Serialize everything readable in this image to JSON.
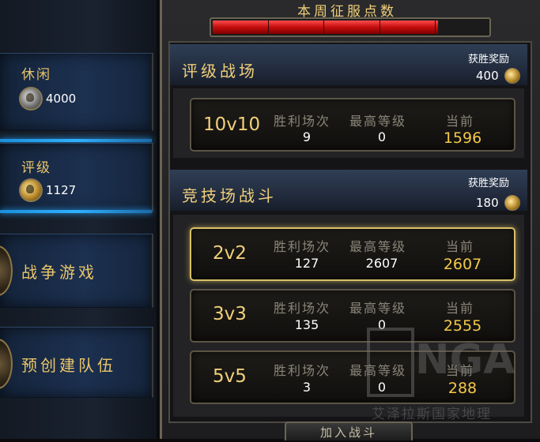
{
  "weekly_conquest": {
    "title": "本周征服点数",
    "progress": 0.82
  },
  "sidebar": {
    "items": [
      {
        "label": "休闲",
        "value": "4000",
        "icon": "silver-conquest-icon"
      },
      {
        "label": "评级",
        "value": "1127",
        "icon": "gold-conquest-icon"
      },
      {
        "label": "战争游戏"
      },
      {
        "label": "预创建队伍"
      }
    ]
  },
  "rated_battleground": {
    "title": "评级战场",
    "reward_label": "获胜奖励",
    "reward_value": "400",
    "rows": [
      {
        "bracket": "10v10",
        "wins_label": "胜利场次",
        "wins": "9",
        "best_label": "最高等级",
        "best": "0",
        "current_label": "当前",
        "current": "1596"
      }
    ]
  },
  "arena": {
    "title": "竞技场战斗",
    "reward_label": "获胜奖励",
    "reward_value": "180",
    "rows": [
      {
        "bracket": "2v2",
        "wins_label": "胜利场次",
        "wins": "127",
        "best_label": "最高等级",
        "best": "2607",
        "current_label": "当前",
        "current": "2607"
      },
      {
        "bracket": "3v3",
        "wins_label": "胜利场次",
        "wins": "135",
        "best_label": "最高等级",
        "best": "0",
        "current_label": "当前",
        "current": "2555"
      },
      {
        "bracket": "5v5",
        "wins_label": "胜利场次",
        "wins": "3",
        "best_label": "最高等级",
        "best": "0",
        "current_label": "当前",
        "current": "288"
      }
    ]
  },
  "join_button": "加入战斗",
  "watermark": {
    "logo": "NGA",
    "subtitle": "艾泽拉斯国家地理"
  },
  "colors": {
    "gold_text": "#f1d07a",
    "current_value": "#f3c94a",
    "progress_red": "#c20d0d",
    "sidebar_blue": "#2fb0ff"
  }
}
